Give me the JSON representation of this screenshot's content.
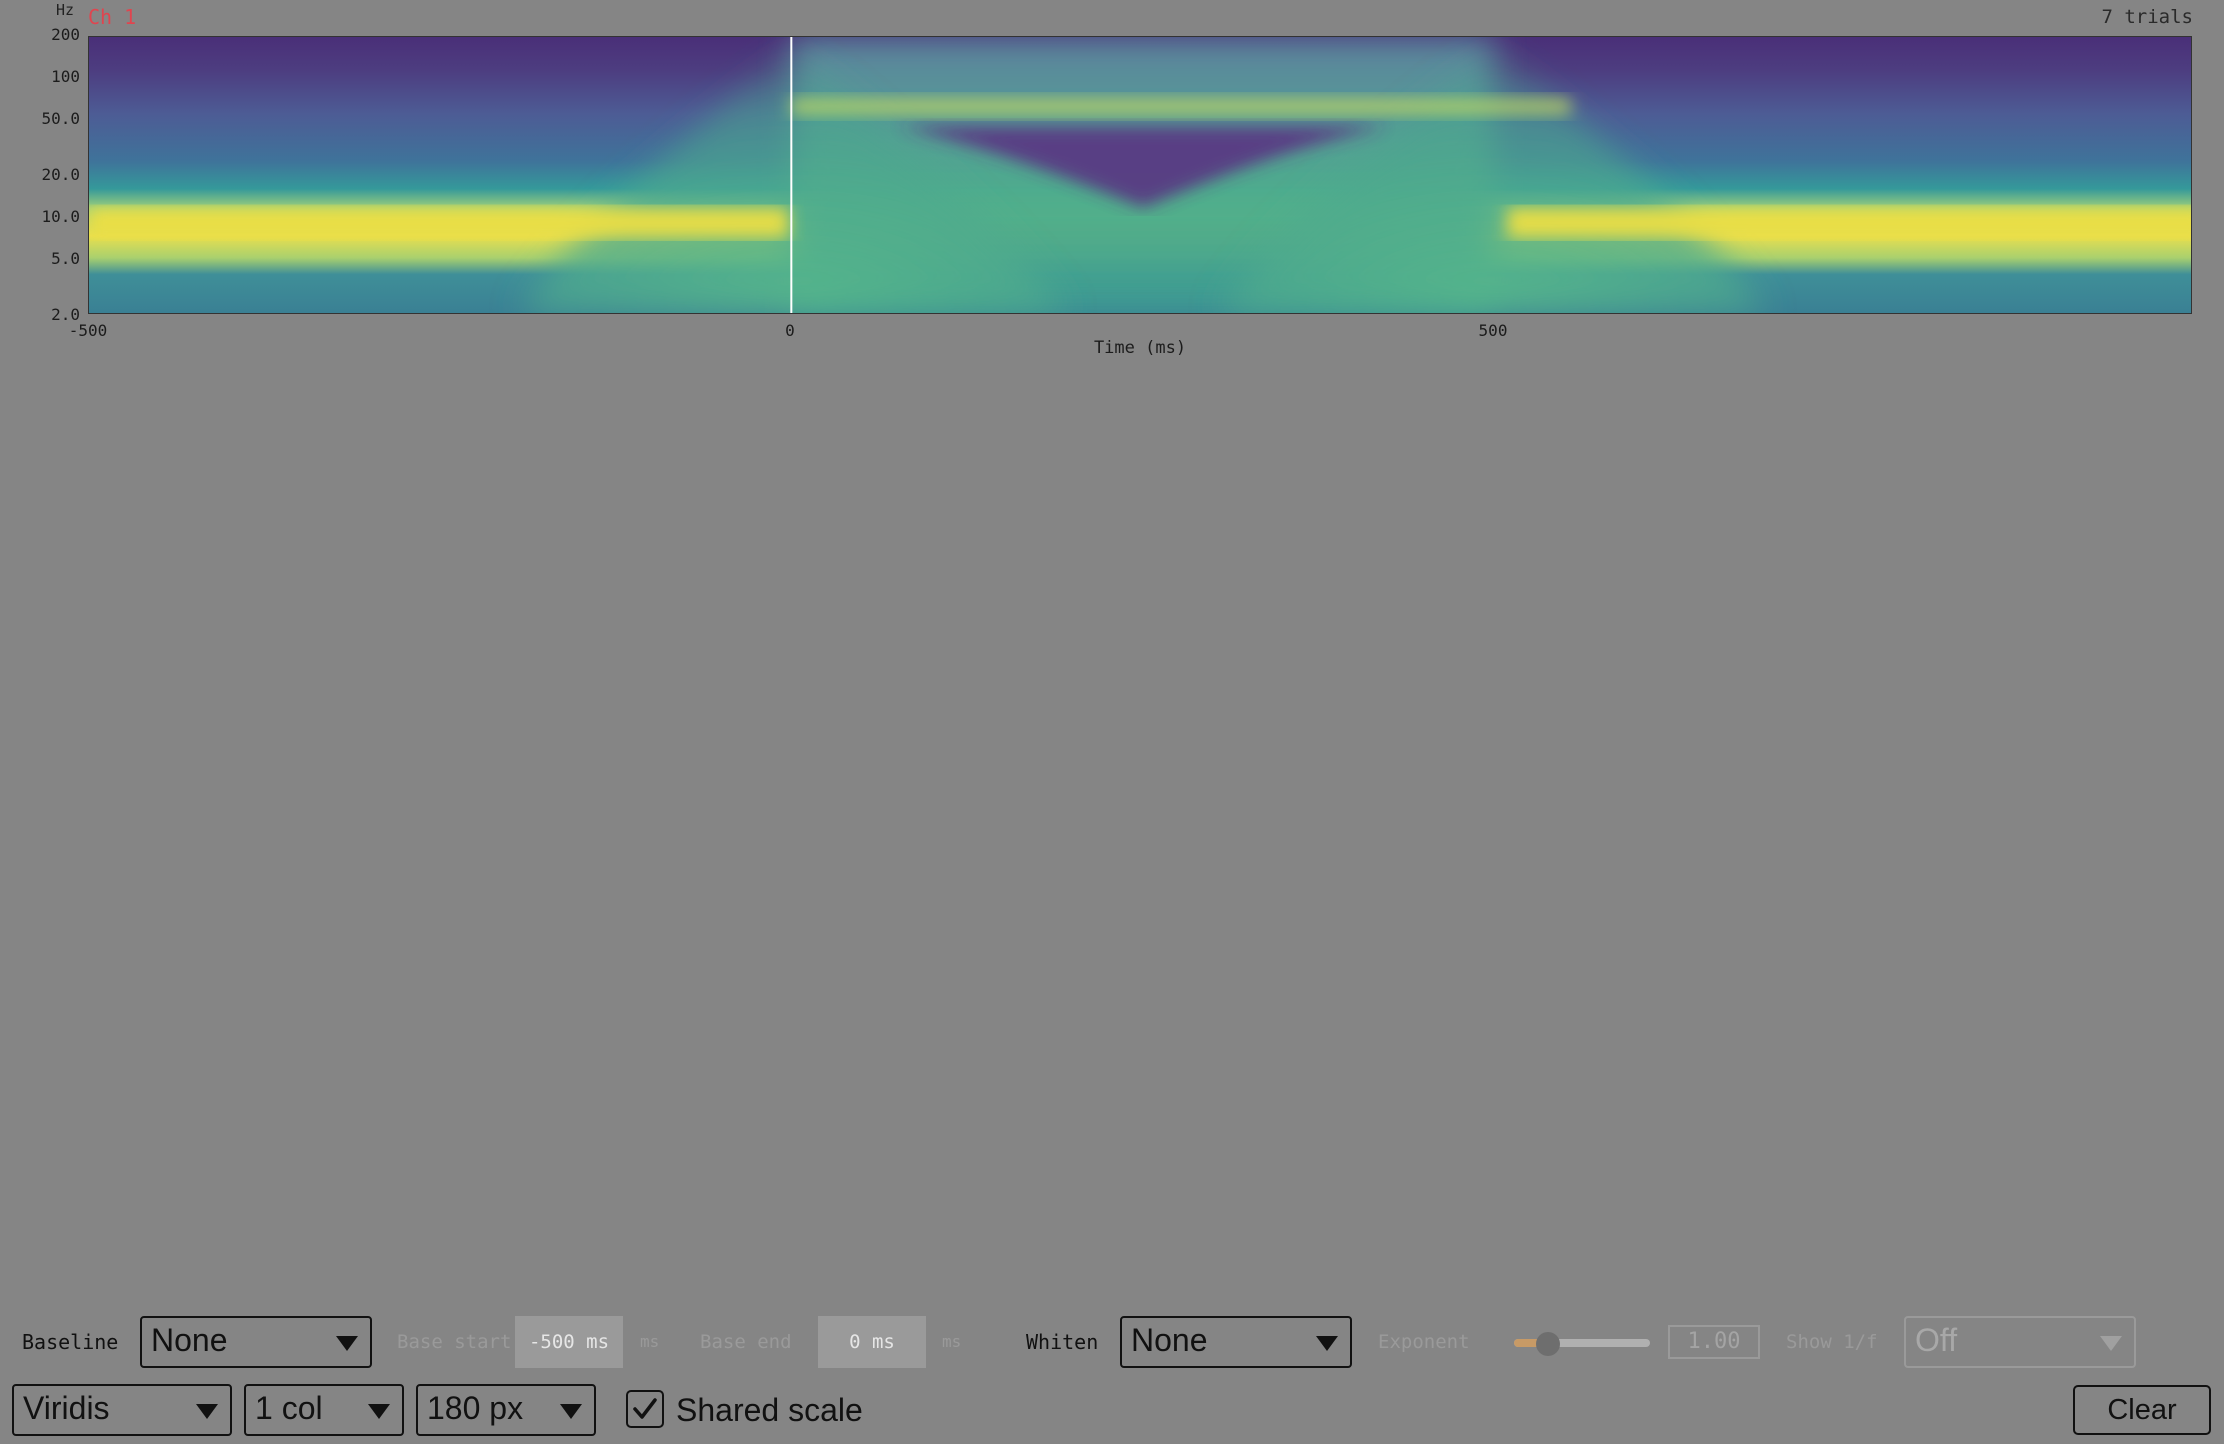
{
  "plot": {
    "channel_label": "Ch 1",
    "trials_label": "7 trials",
    "y_unit": "Hz",
    "y_ticks": [
      "200",
      "100",
      "50.0",
      "20.0",
      "10.0",
      "5.0",
      "2.0"
    ],
    "x_ticks": [
      "-500",
      "0",
      "500"
    ],
    "xlabel": "Time (ms)"
  },
  "chart_data": {
    "type": "heatmap",
    "title": "Ch 1",
    "xlabel": "Time (ms)",
    "ylabel": "Hz",
    "xlim": [
      -500,
      996
    ],
    "ylim": [
      2,
      200
    ],
    "y_scale": "log",
    "x_ticks": [
      -500,
      0,
      500
    ],
    "y_ticks": [
      200,
      100,
      50,
      20,
      10,
      5,
      2
    ],
    "colormap": "Viridis",
    "event_marker_x": 0,
    "features": [
      {
        "band_hz": [
          5,
          10
        ],
        "time_ms": [
          -500,
          0
        ],
        "level": "high"
      },
      {
        "band_hz": [
          5,
          10
        ],
        "time_ms": [
          500,
          996
        ],
        "level": "high"
      },
      {
        "band_hz": [
          55,
          70
        ],
        "time_ms": [
          0,
          500
        ],
        "level": "medium-high"
      },
      {
        "band_hz": [
          15,
          50
        ],
        "time_ms": [
          100,
          400
        ],
        "level": "low"
      }
    ],
    "grid": false
  },
  "controls": {
    "baseline_label": "Baseline",
    "baseline_value": "None",
    "base_start_label": "Base start",
    "base_start_value": "-500 ms",
    "base_start_unit": "ms",
    "base_end_label": "Base end",
    "base_end_value": "0 ms",
    "base_end_unit": "ms",
    "whiten_label": "Whiten",
    "whiten_value": "None",
    "exponent_label": "Exponent",
    "exponent_value": "1.00",
    "exponent_fraction": 0.25,
    "show_1f_label": "Show 1/f",
    "show_1f_value": "Off",
    "colormap_value": "Viridis",
    "columns_value": "1 col",
    "height_value": "180 px",
    "shared_scale_label": "Shared scale",
    "shared_scale_checked": true,
    "clear_label": "Clear"
  }
}
